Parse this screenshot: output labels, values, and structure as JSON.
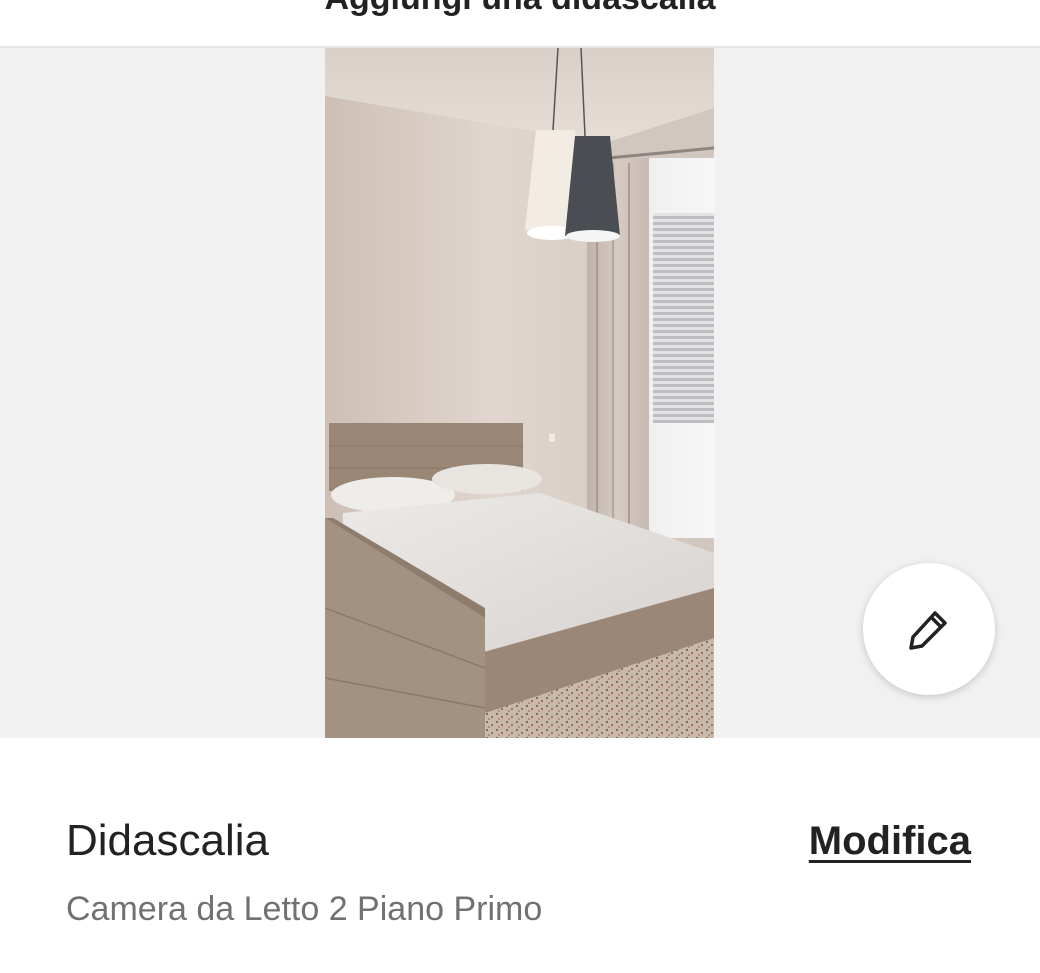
{
  "header": {
    "title": "Aggiungi una didascalia"
  },
  "photo": {
    "subject": "bedroom-photo"
  },
  "edit_fab": {
    "icon": "pencil-icon"
  },
  "caption": {
    "label": "Didascalia",
    "edit_label": "Modifica",
    "value": "Camera da Letto 2 Piano Primo"
  },
  "colors": {
    "text_primary": "#222222",
    "text_secondary": "#717171",
    "photo_background": "#f1f1f1"
  }
}
